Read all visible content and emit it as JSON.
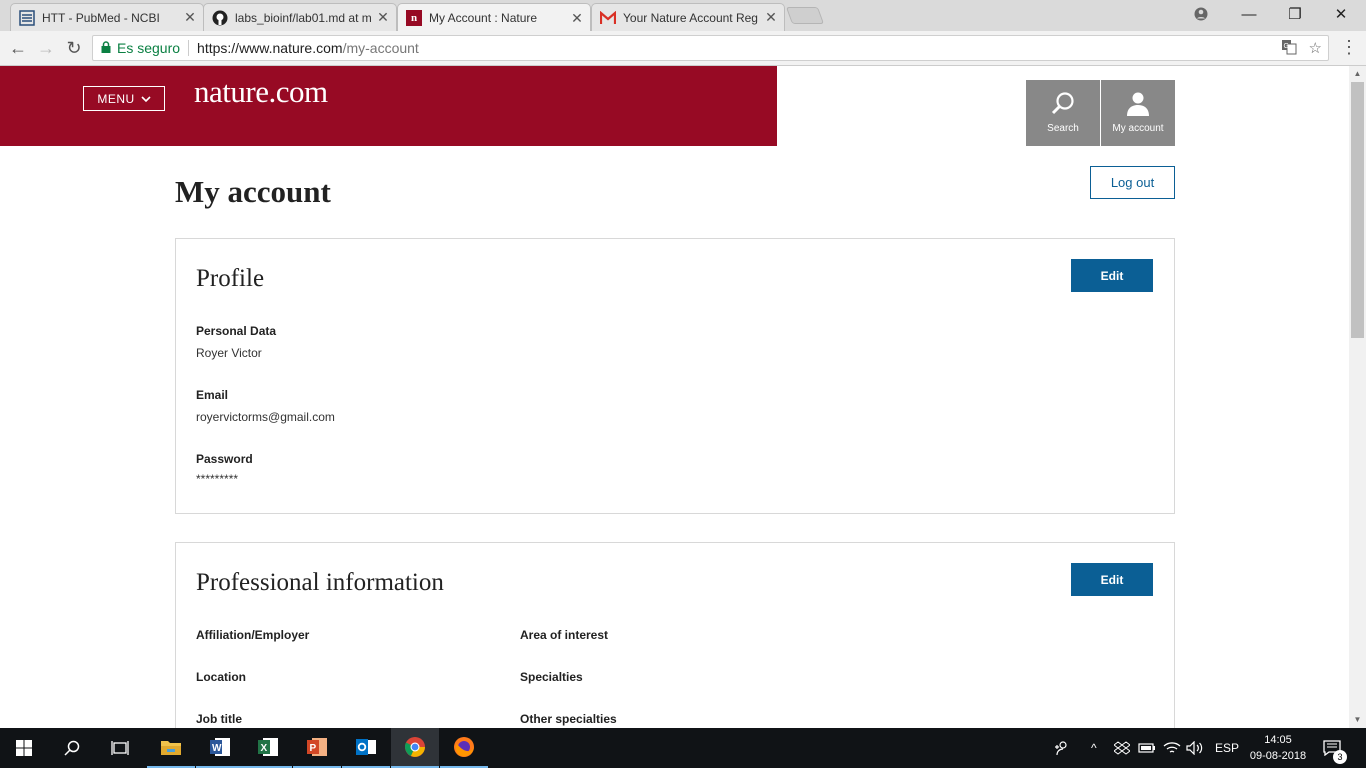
{
  "browser": {
    "tabs": [
      {
        "title": "HTT - PubMed - NCBI",
        "icon": "ncbi-icon"
      },
      {
        "title": "labs_bioinf/lab01.md at m",
        "icon": "github-icon"
      },
      {
        "title": "My Account : Nature",
        "icon": "nature-icon",
        "active": true
      },
      {
        "title": "Your Nature Account Reg",
        "icon": "gmail-icon"
      }
    ],
    "secure_label": "Es seguro",
    "url_host": "https://www.nature.com",
    "url_path": "/my-account"
  },
  "site": {
    "menu_label": "MENU",
    "logo": "nature.com",
    "search_label": "Search",
    "account_label": "My account",
    "brand_color": "#970a24"
  },
  "page": {
    "title": "My account",
    "logout_label": "Log out"
  },
  "profile": {
    "title": "Profile",
    "edit_label": "Edit",
    "personal_data_label": "Personal Data",
    "personal_data_value": "Royer Victor",
    "email_label": "Email",
    "email_value": "royervictorms@gmail.com",
    "password_label": "Password",
    "password_value": "*********"
  },
  "professional": {
    "title": "Professional information",
    "edit_label": "Edit",
    "affiliation_label": "Affiliation/Employer",
    "area_label": "Area of interest",
    "location_label": "Location",
    "specialties_label": "Specialties",
    "job_title_label": "Job title",
    "other_specialties_label": "Other specialties"
  },
  "taskbar": {
    "language": "ESP",
    "time": "14:05",
    "date": "09-08-2018",
    "notification_count": "3"
  }
}
